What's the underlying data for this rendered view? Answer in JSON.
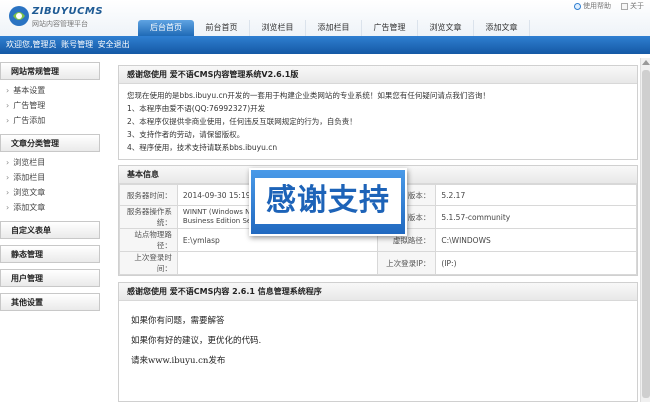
{
  "app": {
    "logo_text": "ZIBUYUCMS",
    "logo_sub": "网站内容管理平台"
  },
  "top_links": {
    "help": "使用帮助",
    "about": "关于"
  },
  "nav": {
    "tabs": [
      "后台首页",
      "前台首页",
      "浏览栏目",
      "添加栏目",
      "广告管理",
      "浏览文章",
      "添加文章"
    ],
    "active_index": 0
  },
  "welcome_bar": {
    "text_prefix": "欢迎您,管理员",
    "account": "账号管理",
    "logout": "安全退出"
  },
  "sidebar": {
    "groups": [
      {
        "title": "网站常规管理",
        "items": [
          "基本设置",
          "广告管理",
          "广告添加"
        ]
      },
      {
        "title": "文章分类管理",
        "items": [
          "浏览栏目",
          "添加栏目",
          "浏览文章",
          "添加文章"
        ]
      },
      {
        "title": "自定义表单",
        "items": []
      },
      {
        "title": "静态管理",
        "items": []
      },
      {
        "title": "用户管理",
        "items": []
      },
      {
        "title": "其他设置",
        "items": []
      }
    ]
  },
  "intro_panel": {
    "title": "感谢您使用 爱不语CMS内容管理系统V2.6.1版",
    "lines": [
      "您现在使用的是bbs.ibuyu.cn开发的一套用于构建企业类网站的专业系统！如果您有任何疑问请点我们咨询！",
      "1、本程序由爱不语(QQ:76992327)开发",
      "2、本程序仅提供非商业使用，任何违反互联网规定的行为，自负责！",
      "3、支持作者的劳动，请保留版权。",
      "4、程序使用，技术支持请联系bbs.ibuyu.cn"
    ]
  },
  "info_panel": {
    "title": "基本信息",
    "rows": [
      [
        "服务器时间：",
        "2014-09-30 15:19",
        "版本：",
        "5.2.17"
      ],
      [
        "服务器操作系统：",
        "WINNT (Windows NT 6.1 build 7601 (Windows 7 Business Edition Service Pack 1) i586)3780)",
        "版本：",
        "5.1.57-community"
      ],
      [
        "站点物理路径：",
        "E:\\ymlasp",
        "虚拟路径：",
        "C:\\WINDOWS"
      ],
      [
        "上次登录时间：",
        "",
        "上次登录IP：",
        "(IP:)"
      ]
    ]
  },
  "cms_panel": {
    "title": "感谢您使用 爱不语CMS内容 2.6.1 信息管理系统程序",
    "lines": [
      "如果你有问题，需要解答",
      "如果你有好的建议，更优化的代码.",
      "请来www.ibuyu.cn发布"
    ]
  },
  "overlay": {
    "text": "感谢支持"
  },
  "colors": {
    "accent": "#1f6ab6",
    "bar": "#1d66b5",
    "overlay": "#2f80d8"
  }
}
